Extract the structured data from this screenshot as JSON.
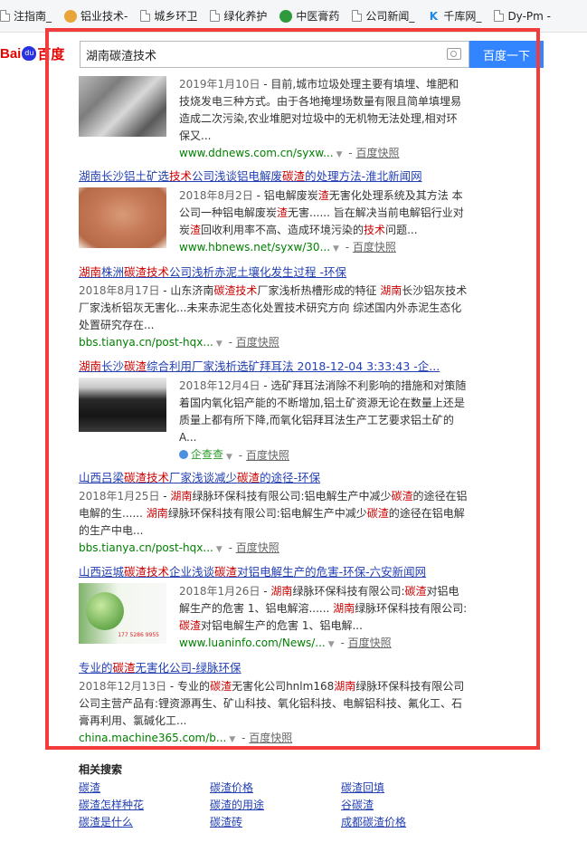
{
  "bookmarks": [
    {
      "label": "注指南_",
      "icon": "page-icon"
    },
    {
      "label": "铝业技术-",
      "icon": "round-icon"
    },
    {
      "label": "城乡环卫",
      "icon": "page-icon"
    },
    {
      "label": "绿化养护",
      "icon": "page-icon"
    },
    {
      "label": "中医膏药",
      "icon": "green-icon"
    },
    {
      "label": "公司新闻_",
      "icon": "page-icon"
    },
    {
      "label": "千库网_",
      "icon": "k-icon"
    },
    {
      "label": "Dy-Pm -",
      "icon": "page-icon"
    }
  ],
  "logo": {
    "bai": "Bai",
    "du": "du",
    "text": "百度"
  },
  "search": {
    "query": "湖南碳渣技术",
    "button": "百度一下"
  },
  "results": [
    {
      "title": "",
      "date": "2019年1月10日",
      "abstract": " - 目前,城市垃圾处理主要有填埋、堆肥和技烧发电三种方式。由于各地掩埋场数量有限且简单填埋易造成二次污染,农业堆肥对垃圾中的无机物无法处理,相对环保又...",
      "url": "www.ddnews.com.cn/syxw...",
      "snapshot": "百度快照"
    },
    {
      "title_parts": [
        "湖南长沙铝土矿选",
        "技术",
        "公司浅谈铝电解废",
        "碳渣",
        "的处理方法-淮北新闻网"
      ],
      "date": "2018年8月2日",
      "abstract_parts": [
        " - 铝电解废炭",
        "渣",
        "无害化处理系统及其方法 本公司一种铝电解废炭",
        "渣",
        "无害...... 旨在解决当前电解铝行业对炭",
        "渣",
        "回收利用率不高、造成环境污染的",
        "技术",
        "问题..."
      ],
      "url": "www.hbnews.net/syxw/30...",
      "snapshot": "百度快照"
    },
    {
      "title_parts": [
        "湖南",
        "株洲",
        "碳渣技术",
        "公司浅析赤泥土壤化发生过程 -环保"
      ],
      "date": "2018年8月17日",
      "abstract_parts": [
        " - 山东济南",
        "碳渣技术",
        "厂家浅析热槽形成的特征 ",
        "湖南",
        "长沙铝灰技术厂家浅析铝灰无害化...未来赤泥生态化处置技术研究方向 综述国内外赤泥生态化处置研究存在..."
      ],
      "url": "bbs.tianya.cn/post-hqx...",
      "snapshot": "百度快照"
    },
    {
      "title_parts": [
        "湖南",
        "长沙",
        "碳渣",
        "综合利用厂家浅析选矿拜耳法 2018-12-04 3:33:43 -企..."
      ],
      "date": "2018年12月4日",
      "abstract": " - 选矿拜耳法消除不利影响的措施和对策随着国内氧化铝产能的不断增加,铝土矿资源无论在数量上还是质量上都有所下降,而氧化铝拜耳法生产工艺要求铝土矿的A...",
      "qcc": "企查查",
      "snapshot": "百度快照"
    },
    {
      "title_parts": [
        "山西吕梁",
        "碳渣技术",
        "厂家浅谈减少",
        "碳渣",
        "的途径-环保"
      ],
      "date": "2018年1月25日",
      "abstract_parts": [
        " - ",
        "湖南",
        "绿脉环保科技有限公司:铝电解生产中减少",
        "碳渣",
        "的途径在铝电解的生...... ",
        "湖南",
        "绿脉环保科技有限公司:铝电解生产中减少",
        "碳渣",
        "的途径在铝电解的生产中电..."
      ],
      "url": "bbs.tianya.cn/post-hqx...",
      "snapshot": "百度快照"
    },
    {
      "title_parts": [
        "山西运城",
        "碳渣技术",
        "企业浅谈",
        "碳渣",
        "对铝电解生产的危害-环保-六安新闻网"
      ],
      "date": "2018年1月26日",
      "abstract_parts": [
        " - ",
        "湖南",
        "绿脉环保科技有限公司:",
        "碳渣",
        "对铝电解生产的危害 1、铝电解溶...... ",
        "湖南",
        "绿脉环保科技有限公司:",
        "碳渣",
        "对铝电解生产的危害 1、铝电解..."
      ],
      "thumb_text": "177 5286 9955",
      "url": "www.luaninfo.com/News/...",
      "snapshot": "百度快照"
    },
    {
      "title_parts": [
        "专业的",
        "碳渣",
        "无害化公司-绿脉环保"
      ],
      "date": "2018年12月13日",
      "abstract_parts": [
        " - 专业的",
        "碳渣",
        "无害化公司hnlm168",
        "湖南",
        "绿脉环保科技有限公司公司主营产品有:锂资源再生、矿山科技、氧化铝科技、电解铝科技、氟化工、石膏再利用、氯碱化工..."
      ],
      "url": "china.machine365.com/b...",
      "snapshot": "百度快照"
    }
  ],
  "related": {
    "title": "相关搜索",
    "items": [
      "碳渣",
      "碳渣价格",
      "碳渣回填",
      "碳渣怎样种花",
      "碳渣的用途",
      "谷碳渣",
      "碳渣是什么",
      "碳渣砖",
      "成都碳渣价格"
    ]
  },
  "colors": {
    "link": "#2440b3",
    "highlight": "#c00",
    "url": "#008000",
    "button": "#3385ff",
    "frame": "#f23b3b"
  }
}
